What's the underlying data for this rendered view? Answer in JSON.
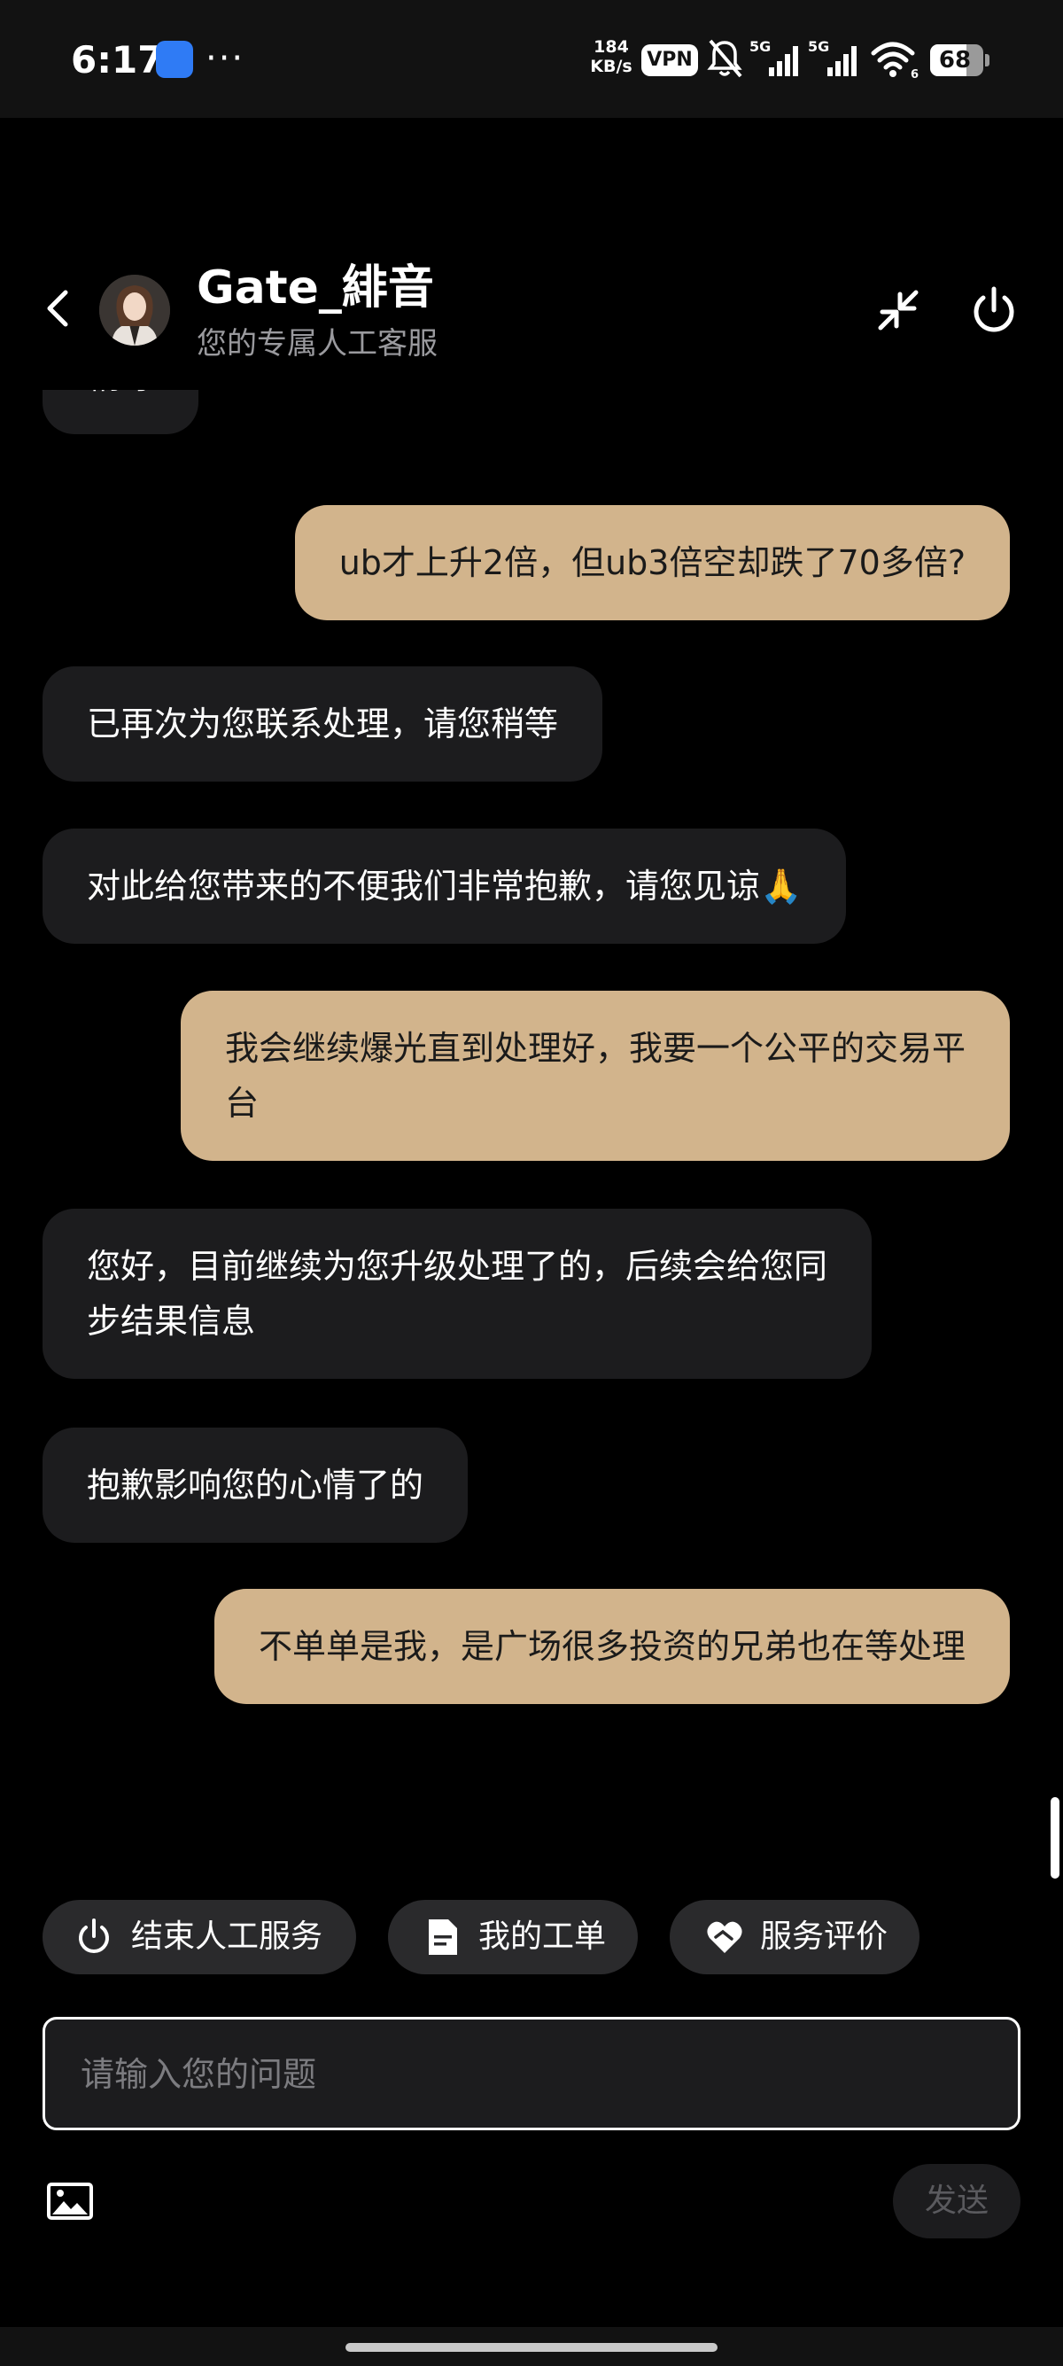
{
  "status_bar": {
    "time": "6:17",
    "dots": "···",
    "speed_value": "184",
    "speed_unit": "KB/s",
    "vpn": "VPN",
    "battery": "68",
    "battery_level": 0.68
  },
  "header": {
    "name": "Gate_緋音",
    "subtitle": "您的专属人工客服"
  },
  "messages": [
    {
      "from": "agent",
      "text": "稍等"
    },
    {
      "from": "user",
      "text": "ub才上升2倍，但ub3倍空却跌了70多倍?"
    },
    {
      "from": "agent",
      "text": "已再次为您联系处理，请您稍等"
    },
    {
      "from": "agent",
      "text": "对此给您带来的不便我们非常抱歉，请您见谅🙏"
    },
    {
      "from": "user",
      "text": "我会继续爆光直到处理好，我要一个公平的交易平\n台"
    },
    {
      "from": "agent",
      "text": "您好，目前继续为您升级处理了的，后续会给您同\n步结果信息"
    },
    {
      "from": "agent",
      "text": "抱歉影响您的心情了的"
    },
    {
      "from": "user",
      "text": "不单单是我，是广场很多投资的兄弟也在等处理"
    }
  ],
  "quick_actions": {
    "end_service": "结束人工服务",
    "my_tickets": "我的工单",
    "rate_service": "服务评价"
  },
  "input": {
    "placeholder": "请输入您的问题",
    "send_label": "发送"
  },
  "colors": {
    "user_bubble": "#d2b48c",
    "agent_bubble": "#1c1c1e",
    "background": "#000000"
  }
}
